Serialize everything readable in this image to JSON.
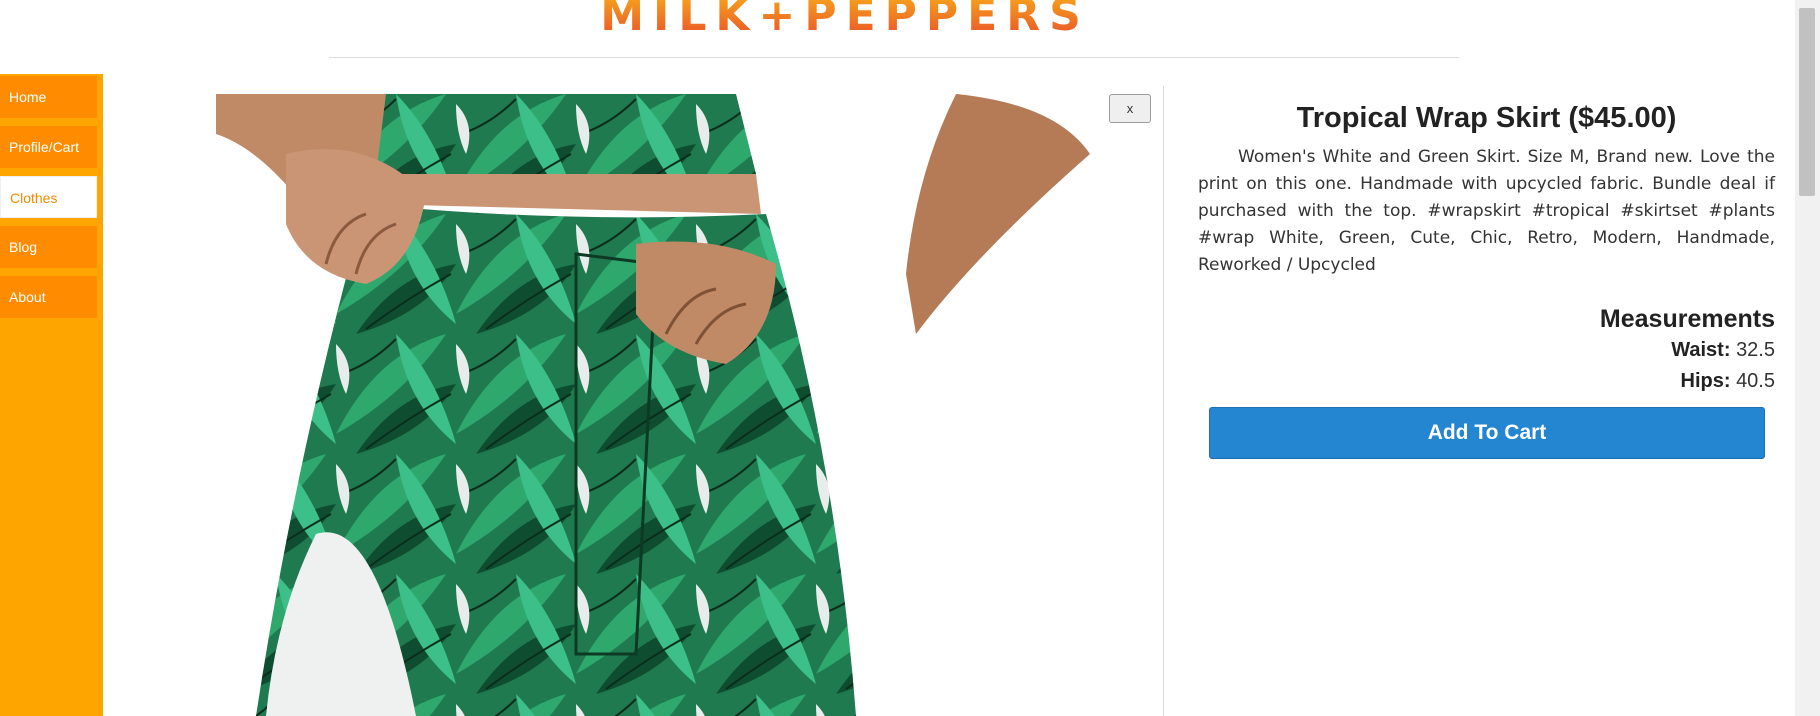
{
  "brand": {
    "logo_text": "MILK+PEPPERS"
  },
  "sidebar": {
    "items": [
      {
        "label": "Home",
        "active": false
      },
      {
        "label": "Profile/Cart",
        "active": false
      },
      {
        "label": "Clothes",
        "active": true
      },
      {
        "label": "Blog",
        "active": false
      },
      {
        "label": "About",
        "active": false
      }
    ]
  },
  "modal": {
    "close_label": "x",
    "product": {
      "title": "Tropical Wrap Skirt ($45.00)",
      "description": "Women's White and Green Skirt. Size M, Brand new. Love the print on this one. Handmade with upcycled fabric. Bundle deal if purchased with the top. #wrapskirt #tropical #skirtset #plants #wrap White, Green, Cute, Chic, Retro, Modern, Handmade, Reworked / Upcycled",
      "measurements_heading": "Measurements",
      "measurements": [
        {
          "label": "Waist:",
          "value": "32.5"
        },
        {
          "label": "Hips:",
          "value": "40.5"
        }
      ],
      "add_to_cart_label": "Add To Cart"
    }
  },
  "colors": {
    "sidebar_bg": "#ffa500",
    "nav_item_bg": "#ff8c00",
    "button_blue": "#2485d0",
    "logo_orange": "#e8582a"
  },
  "icons": {
    "close": "close-icon"
  }
}
